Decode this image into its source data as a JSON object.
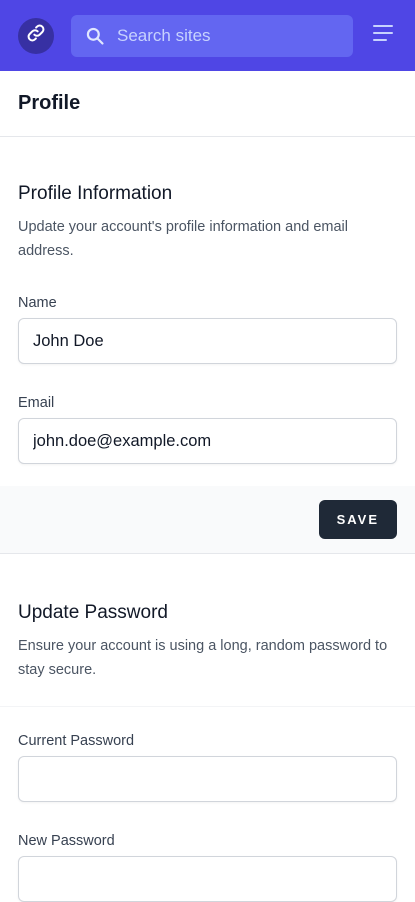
{
  "topbar": {
    "logo_icon": "link-icon",
    "search": {
      "placeholder": "Search sites",
      "icon": "search-icon"
    },
    "menu_icon": "hamburger-menu-icon",
    "colors": {
      "bar": "#4f46e5",
      "search_bg": "#6366f1"
    }
  },
  "page": {
    "title": "Profile"
  },
  "profile_info": {
    "title": "Profile Information",
    "description": "Update your account's profile information and email address.",
    "fields": {
      "name": {
        "label": "Name",
        "value": "John Doe"
      },
      "email": {
        "label": "Email",
        "value": "john.doe@example.com"
      }
    },
    "save_label": "SAVE"
  },
  "update_password": {
    "title": "Update Password",
    "description": "Ensure your account is using a long, random password to stay secure.",
    "fields": {
      "current": {
        "label": "Current Password",
        "value": ""
      },
      "new": {
        "label": "New Password",
        "value": ""
      }
    }
  }
}
